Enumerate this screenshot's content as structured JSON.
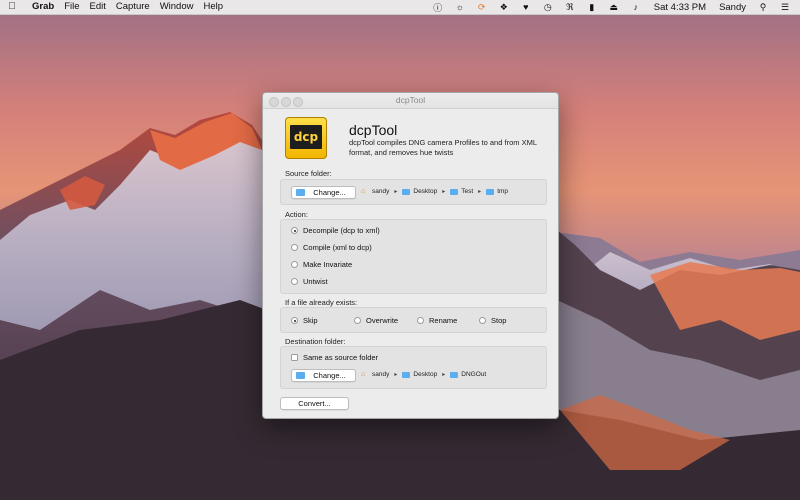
{
  "menubar": {
    "apple_icon": "apple-icon",
    "app_name": "Grab",
    "menus": [
      "File",
      "Edit",
      "Capture",
      "Window",
      "Help"
    ],
    "status_icons": [
      "info-icon",
      "headphones-icon",
      "sync-icon",
      "dropbox-icon",
      "heart-icon",
      "time-machine-icon",
      "bluetooth-icon",
      "battery-icon",
      "eject-icon",
      "volume-icon"
    ],
    "clock": "Sat 4:33 PM",
    "user": "Sandy"
  },
  "window": {
    "title": "dcpTool",
    "app_title": "dcpTool",
    "description": "dcpTool compiles DNG camera Profiles to and from XML format, and removes hue twists",
    "logo_text": "dcp",
    "source": {
      "label": "Source folder:",
      "button": "Change...",
      "path": [
        "sandy",
        "Desktop",
        "Test",
        "tmp"
      ]
    },
    "action": {
      "label": "Action:",
      "options": [
        "Decompile (dcp to xml)",
        "Compile (xml to dcp)",
        "Make Invariate",
        "Untwist"
      ],
      "selected": "Decompile (dcp to xml)"
    },
    "exists": {
      "label": "If a file already exists:",
      "options": [
        "Skip",
        "Overwrite",
        "Rename",
        "Stop"
      ],
      "selected": "Skip"
    },
    "destination": {
      "label": "Destination folder:",
      "same_as_source": "Same as source folder",
      "same_checked": false,
      "button": "Change...",
      "path": [
        "sandy",
        "Desktop",
        "DNGOut"
      ]
    },
    "convert_button": "Convert..."
  },
  "colors": {
    "accent_folder": "#5aaef0",
    "logo_yellow": "#f1b400"
  }
}
